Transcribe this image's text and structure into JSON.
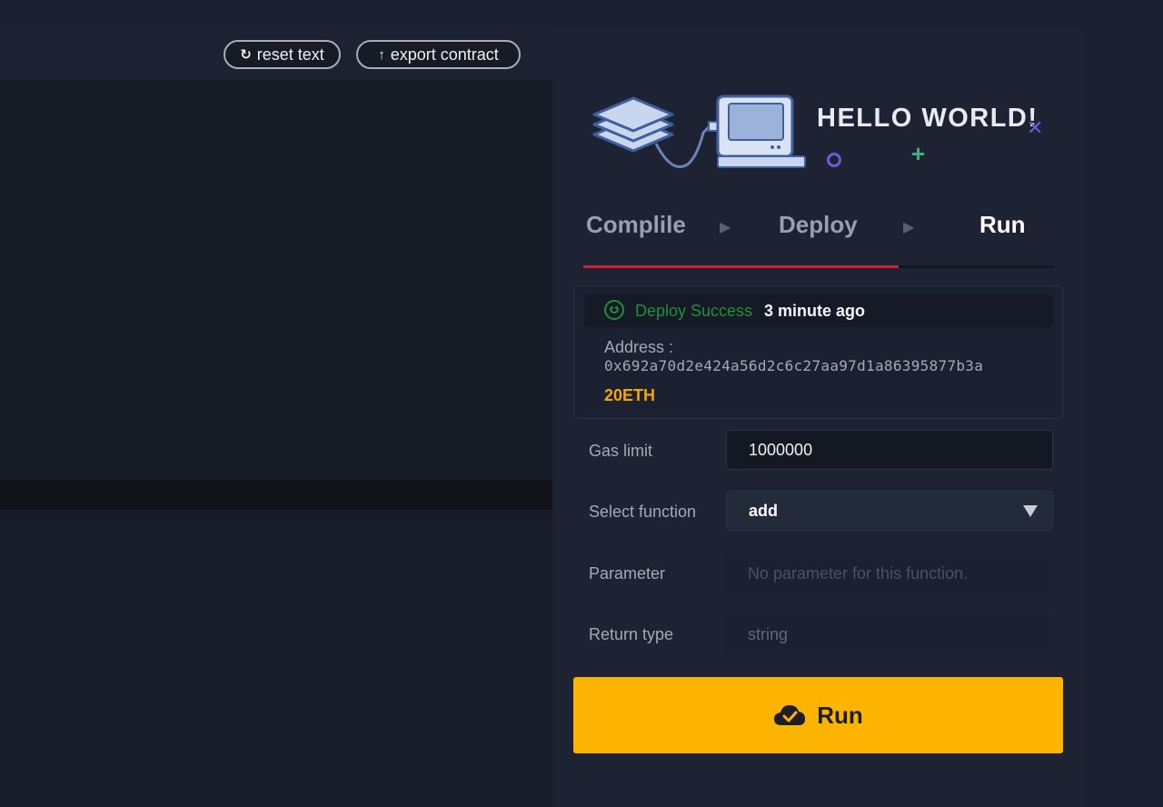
{
  "toolbar": {
    "reset_label": "reset text",
    "export_label": "export contract"
  },
  "hero": {
    "title": "HELLO WORLD!"
  },
  "steps": [
    {
      "label": "Complile",
      "active": false
    },
    {
      "label": "Deploy",
      "active": false
    },
    {
      "label": "Run",
      "active": true
    }
  ],
  "progress": {
    "fraction": 0.67,
    "color": "#d0213a"
  },
  "status": {
    "text": "Deploy Success",
    "time": "3 minute ago",
    "address_label": "Address :",
    "address": "0x692a70d2e424a56d2c6c27aa97d1a86395877b3a",
    "balance": "20ETH"
  },
  "form": {
    "gas_label": "Gas limit",
    "gas_value": "1000000",
    "function_label": "Select function",
    "function_value": "add",
    "parameter_label": "Parameter",
    "parameter_placeholder": "No parameter for this function.",
    "return_label": "Return type",
    "return_value": "string"
  },
  "run_button": {
    "label": "Run"
  },
  "colors": {
    "accent": "#fdb401",
    "success": "#1e8f3a",
    "balance": "#f2a50c",
    "decor_purple": "#6d5bd4",
    "decor_green": "#3fb57e"
  },
  "icons": {
    "reset": "refresh-icon",
    "export": "upload-arrow-icon",
    "status": "smile-icon",
    "run": "cloud-check-icon",
    "select": "caret-down-icon"
  }
}
